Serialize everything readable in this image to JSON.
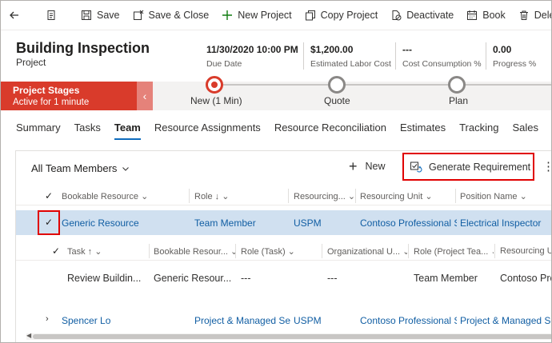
{
  "toolbar": {
    "save": "Save",
    "save_close": "Save & Close",
    "new_project": "New Project",
    "copy_project": "Copy Project",
    "deactivate": "Deactivate",
    "book": "Book",
    "delete": "Delete"
  },
  "header": {
    "title": "Building Inspection",
    "entity": "Project",
    "fields": [
      {
        "value": "11/30/2020 10:00 PM",
        "label": "Due Date"
      },
      {
        "value": "$1,200.00",
        "label": "Estimated Labor Cost"
      },
      {
        "value": "---",
        "label": "Cost Consumption %"
      },
      {
        "value": "0.00",
        "label": "Progress %"
      }
    ]
  },
  "stages": {
    "title": "Project Stages",
    "subtitle": "Active for 1 minute",
    "items": [
      {
        "label": "New  (1 Min)",
        "active": true
      },
      {
        "label": "Quote",
        "active": false
      },
      {
        "label": "Plan",
        "active": false
      }
    ]
  },
  "tabs": [
    "Summary",
    "Tasks",
    "Team",
    "Resource Assignments",
    "Resource Reconciliation",
    "Estimates",
    "Tracking",
    "Sales"
  ],
  "selected_tab": "Team",
  "grid": {
    "view_name": "All Team Members",
    "new_label": "New",
    "generate_label": "Generate Requirement",
    "columns": [
      "Bookable Resource",
      "Role",
      "Resourcing...",
      "Resourcing Unit",
      "Position Name"
    ],
    "rows": [
      {
        "bookable": "Generic Resource",
        "role": "Team Member",
        "resourcing": "USPM",
        "unit": "Contoso Professional S",
        "position": "Electrical Inspector"
      },
      {
        "bookable": "Spencer Lo",
        "role": "Project & Managed Se",
        "resourcing": "USPM",
        "unit": "Contoso Professional S",
        "position": "Project & Managed Se"
      }
    ],
    "sub_columns": [
      "Task",
      "Bookable Resour...",
      "Role (Task)",
      "Organizational U...",
      "Role (Project Tea...",
      "Resourcing Uni"
    ],
    "sub_row": [
      "Review Buildin...",
      "Generic Resour...",
      "---",
      "---",
      "Team Member",
      "Contoso Pro"
    ]
  },
  "colors": {
    "accent_red": "#d93b2b",
    "highlight_box": "#e00000",
    "link": "#115ea3",
    "selected_row": "#d0e0f0"
  }
}
